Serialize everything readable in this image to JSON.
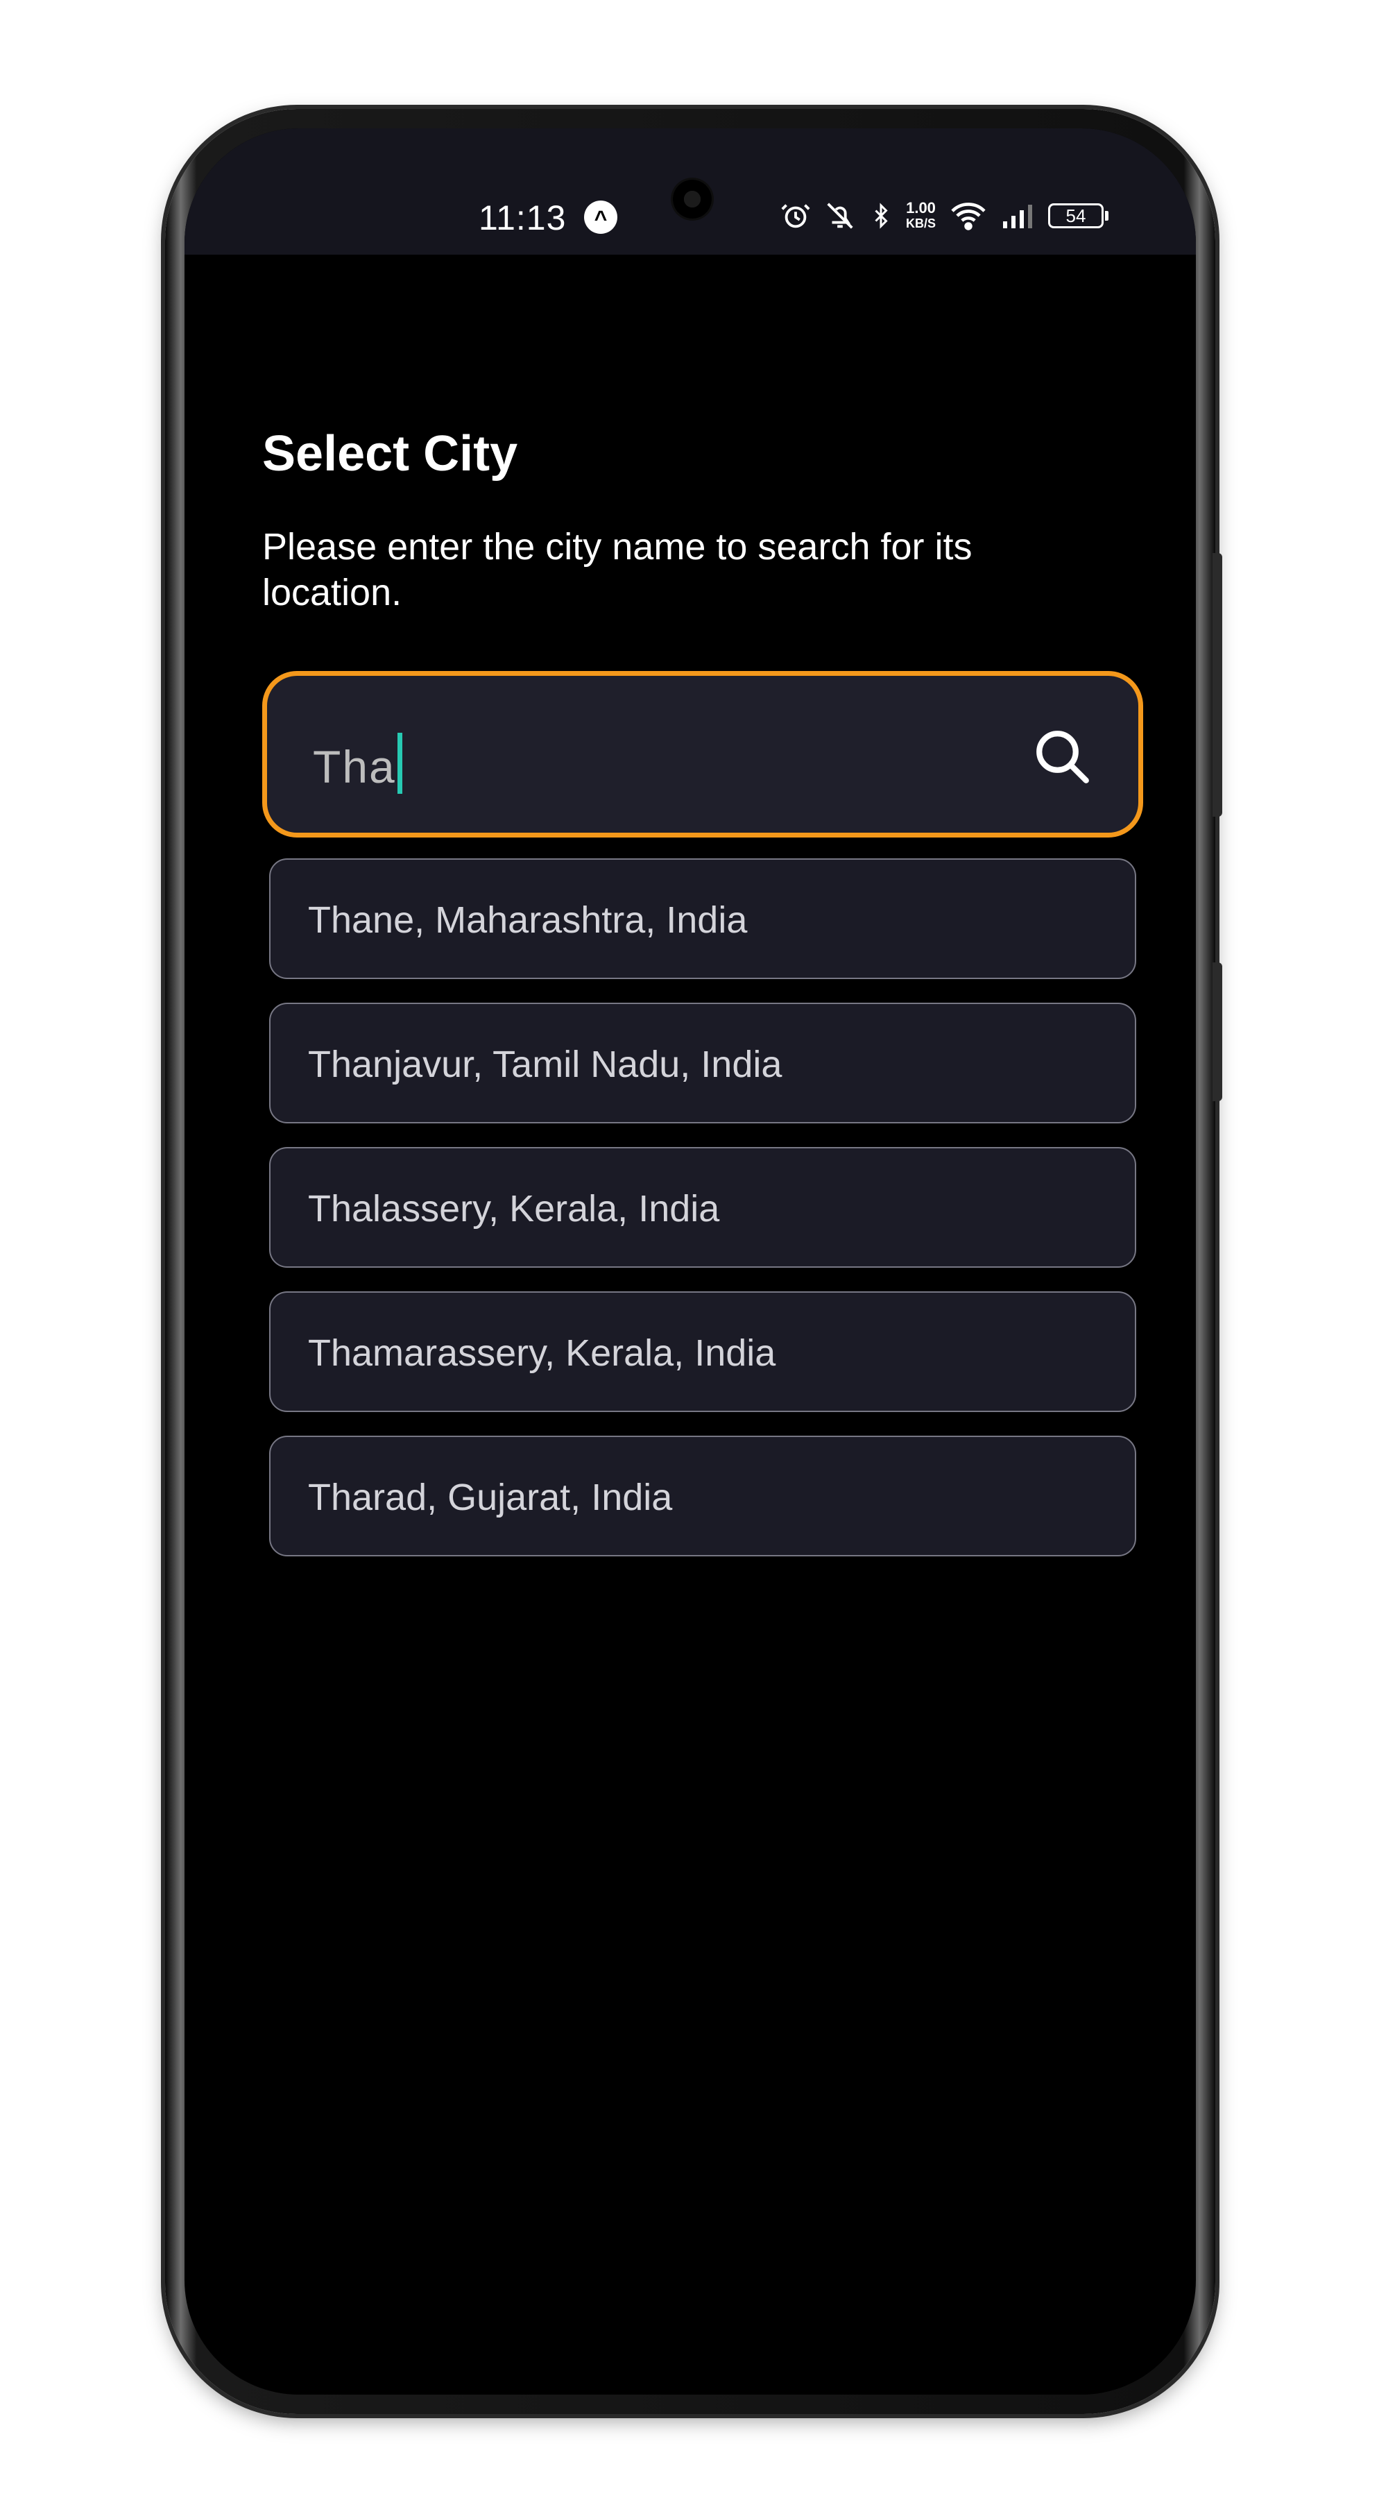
{
  "status_bar": {
    "time": "11:13",
    "speed_top": "1.00",
    "speed_bottom": "KB/S",
    "battery": "54"
  },
  "page": {
    "title": "Select City",
    "subtitle": "Please enter the city name to search for its location."
  },
  "search": {
    "value": "Tha",
    "border_color": "#f4981b",
    "caret_color": "#27c9b2"
  },
  "results": [
    {
      "label": "Thane, Maharashtra, India"
    },
    {
      "label": "Thanjavur, Tamil Nadu, India"
    },
    {
      "label": "Thalassery, Kerala, India"
    },
    {
      "label": "Thamarassery, Kerala, India"
    },
    {
      "label": "Tharad, Gujarat, India"
    }
  ],
  "icons": {
    "status": [
      "alarm-icon",
      "mute-icon",
      "bluetooth-icon",
      "wifi-icon",
      "signal-icon",
      "battery-icon"
    ],
    "search": "search-icon"
  }
}
